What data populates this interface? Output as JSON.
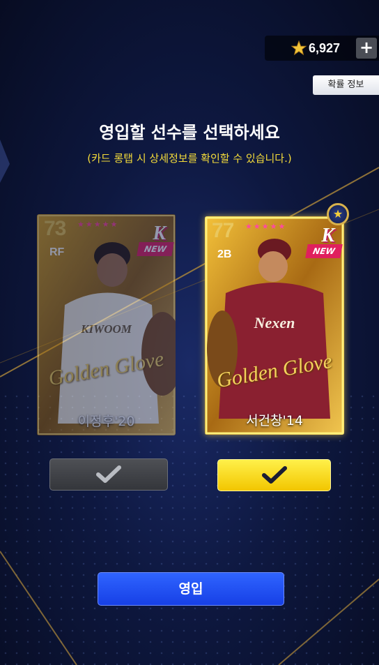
{
  "currency": {
    "icon": "star-coin-icon",
    "amount": "6,927",
    "add_label": "+"
  },
  "probability_button": "확률 정보",
  "title": "영입할 선수를 선택하세요",
  "subtitle": "(카드 롱탭 시 상세정보를 확인할 수 있습니다.)",
  "cards": [
    {
      "rating": "73",
      "position": "RF",
      "stars": "★★★★★",
      "team_logo": "K",
      "new_label": "NEW",
      "jersey_text": "KIWOOM",
      "brand_text": "Golden Glove",
      "name": "이정후'20",
      "selected": false
    },
    {
      "rating": "77",
      "position": "2B",
      "stars": "★★★★★",
      "team_logo": "K",
      "new_label": "NEW",
      "jersey_text": "Nexen",
      "brand_text": "Golden Glove",
      "name": "서건창'14",
      "selected": true
    }
  ],
  "recruit_button": "영입",
  "colors": {
    "accent_blue": "#1f4dff",
    "select_yellow": "#f7d800",
    "subtitle_yellow": "#f5dc3a",
    "gold": "#c9a04a"
  }
}
